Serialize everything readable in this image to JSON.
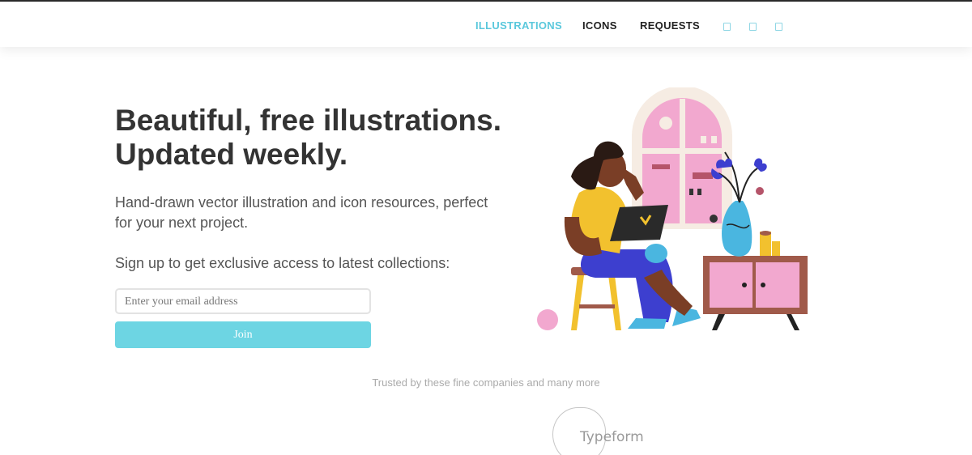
{
  "nav": {
    "items": [
      {
        "label": "ILLUSTRATIONS",
        "active": true
      },
      {
        "label": "ICONS",
        "active": false
      },
      {
        "label": "REQUESTS",
        "active": false
      }
    ],
    "social_icons": [
      "twitter-icon",
      "instagram-icon",
      "dribbble-icon"
    ]
  },
  "hero": {
    "headline_line1": "Beautiful, free illustrations.",
    "headline_line2": "Updated weekly.",
    "subtext": "Hand-drawn vector illustration and icon resources, perfect for your next project.",
    "signup_text": "Sign up to get exclusive access to latest collections:",
    "email_placeholder": "Enter your email address",
    "join_label": "Join"
  },
  "trusted": {
    "text": "Trusted by these fine companies and many more",
    "logos": [
      "Typeform"
    ]
  },
  "colors": {
    "accent": "#6dd5e3",
    "nav_active": "#5bc8dc",
    "headline": "#333333",
    "body_text": "#555555"
  }
}
